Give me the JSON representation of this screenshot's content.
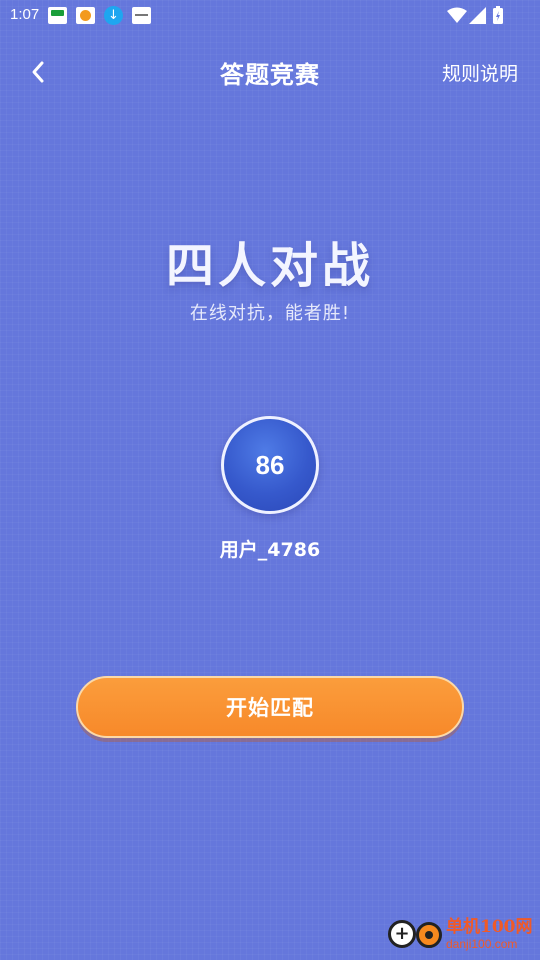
{
  "status_bar": {
    "time": "1:07",
    "notifications": [
      "app-notification-green",
      "app-notification-orange",
      "download-icon",
      "app-notification-white"
    ],
    "icons": [
      "wifi-icon",
      "signal-icon",
      "battery-icon"
    ]
  },
  "header": {
    "title": "答题竞赛",
    "rules_label": "规则说明",
    "back_icon": "chevron-left-icon"
  },
  "hero": {
    "mode_title": "四人对战",
    "subtitle": "在线对抗，能者胜!"
  },
  "player": {
    "score": "86",
    "name": "用户_4786"
  },
  "action": {
    "start_label": "开始匹配"
  },
  "watermark": {
    "name": "单机100网",
    "url": "danji100.com"
  },
  "colors": {
    "background": "#6577dc",
    "avatar": "#3659cc",
    "button": "#f7892a",
    "watermark": "#f05a28"
  }
}
